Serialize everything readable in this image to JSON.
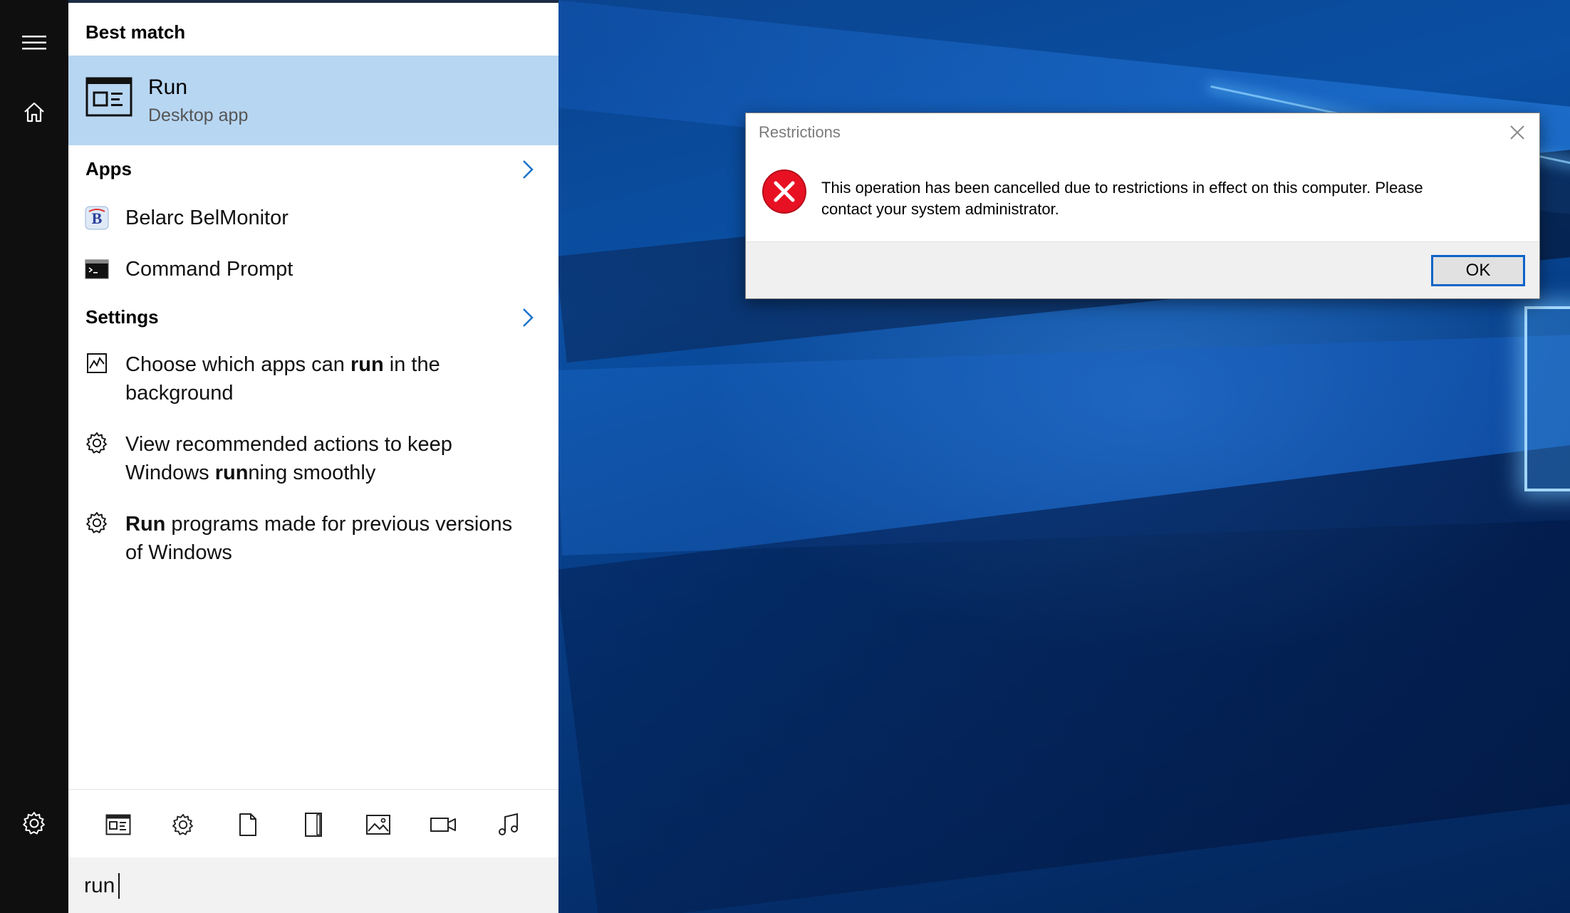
{
  "start_rail": {
    "items": [
      {
        "icon": "hamburger-menu-icon"
      },
      {
        "icon": "home-icon"
      },
      {
        "icon": "settings-gear-icon"
      }
    ]
  },
  "search_panel": {
    "best_match": {
      "header": "Best match",
      "title": "Run",
      "subtitle": "Desktop app",
      "icon": "run-app-icon"
    },
    "apps": {
      "header": "Apps",
      "items": [
        {
          "label": "Belarc BelMonitor",
          "icon": "belarc-icon"
        },
        {
          "label": "Command Prompt",
          "icon": "command-prompt-icon"
        }
      ]
    },
    "settings": {
      "header": "Settings",
      "items": [
        {
          "line1_pre": "Choose which apps can ",
          "line1_bold": "run",
          "line1_post": " in the",
          "line2": "background",
          "icon": "background-apps-icon"
        },
        {
          "line1": "View recommended actions to keep",
          "line2_pre": "Windows ",
          "line2_bold": "run",
          "line2_post": "ning smoothly",
          "icon": "gear-icon"
        },
        {
          "line1_bold": "Run",
          "line1_post": " programs made for previous versions",
          "line2": "of Windows",
          "icon": "gear-icon"
        }
      ]
    },
    "filters": [
      "apps-filter-icon",
      "settings-filter-icon",
      "documents-filter-icon",
      "folders-filter-icon",
      "photos-filter-icon",
      "videos-filter-icon",
      "music-filter-icon"
    ],
    "search_query": "run"
  },
  "dialog": {
    "title": "Restrictions",
    "message_line1": "This operation has been cancelled due to restrictions in effect on this computer. Please",
    "message_line2": "contact your system administrator.",
    "ok_label": "OK",
    "icon": "error-icon",
    "error_color": "#e81123"
  },
  "colors": {
    "rail_bg": "#0f0f0f",
    "selection_bg": "#b7d6f2",
    "accent": "#0a64c8"
  }
}
